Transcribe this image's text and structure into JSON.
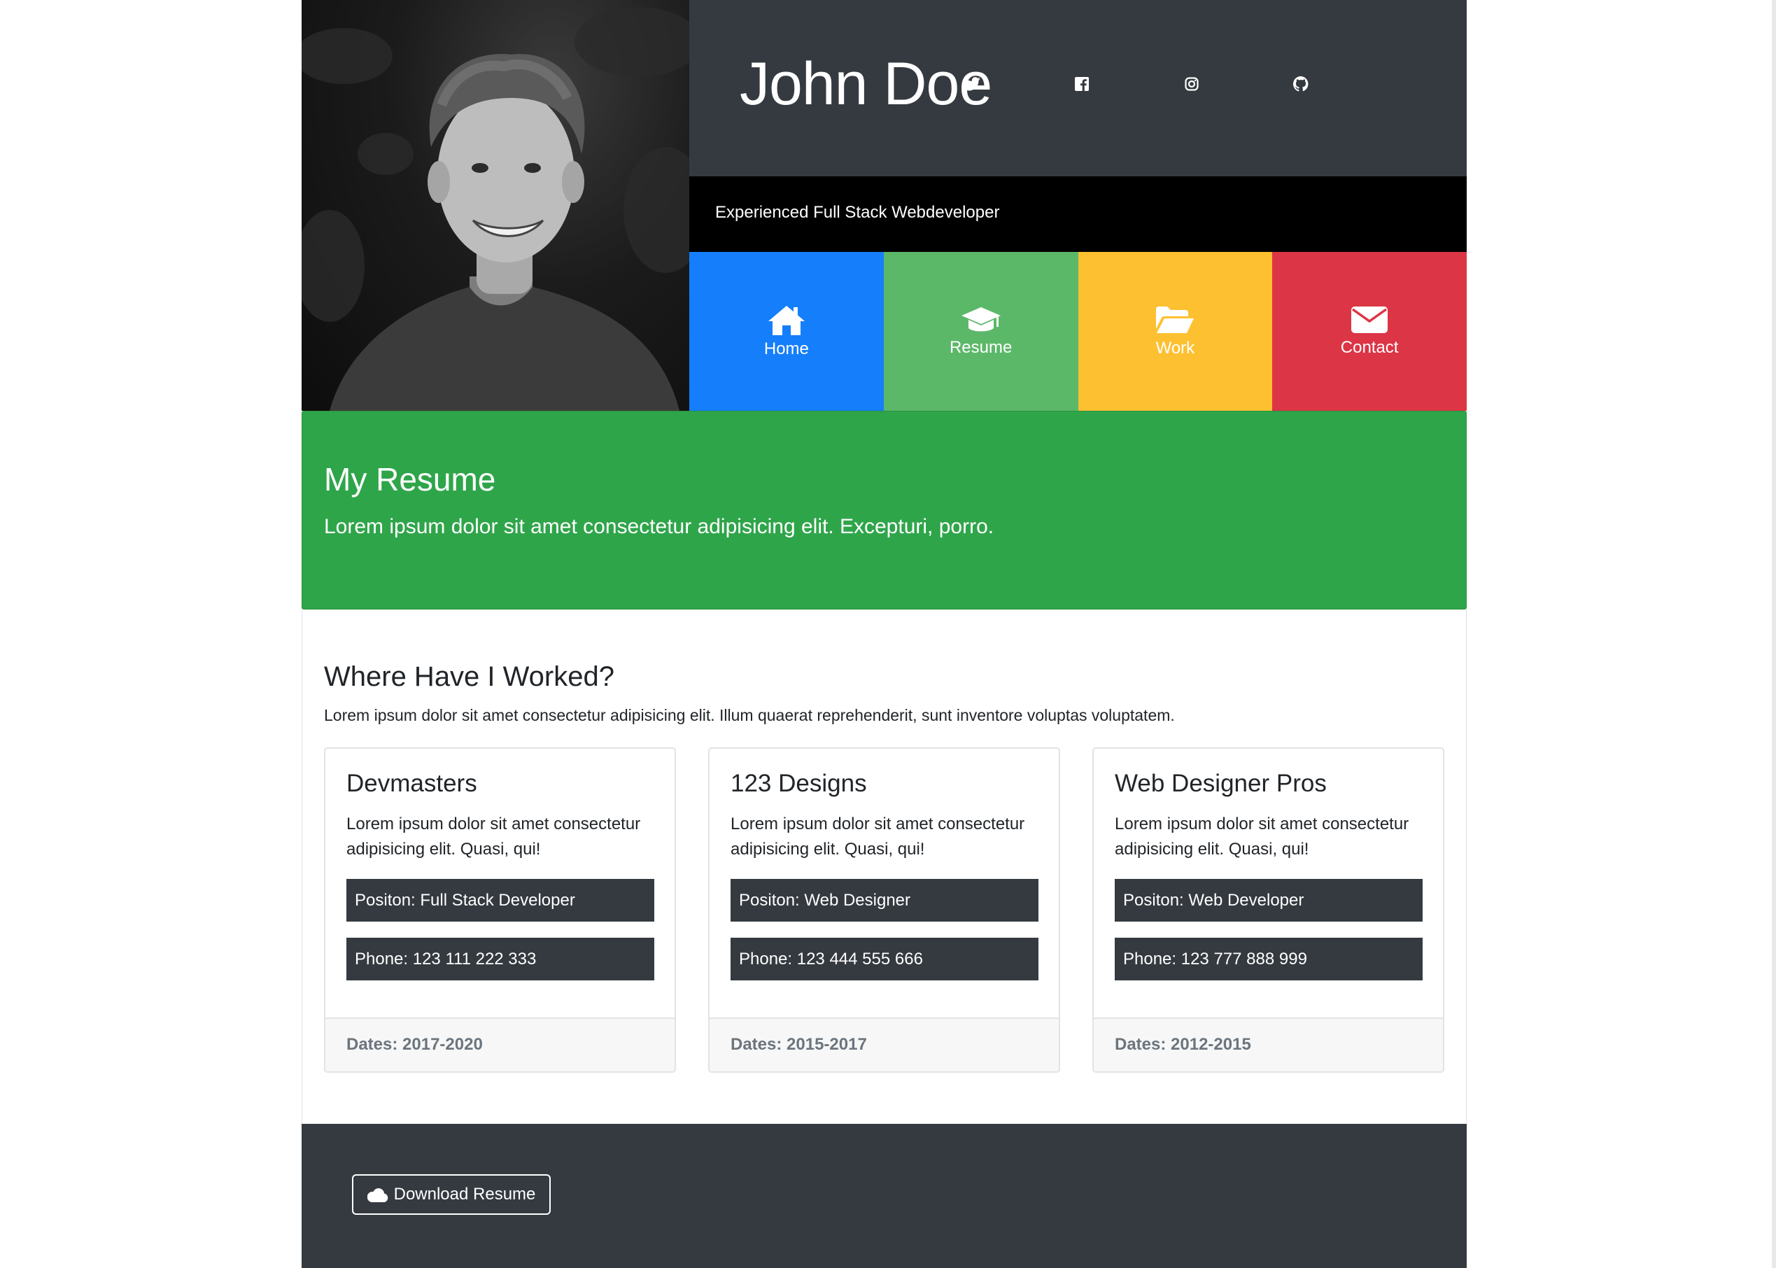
{
  "profile": {
    "name": "John Doe",
    "tagline": "Experienced Full Stack Webdeveloper"
  },
  "social": [
    {
      "icon": "twitter-icon"
    },
    {
      "icon": "facebook-icon"
    },
    {
      "icon": "instagram-icon"
    },
    {
      "icon": "github-icon"
    }
  ],
  "nav": [
    {
      "label": "Home",
      "icon": "home-icon",
      "color": "#157efb"
    },
    {
      "label": "Resume",
      "icon": "graduation-cap-icon",
      "color": "#5cb869"
    },
    {
      "label": "Work",
      "icon": "folder-open-icon",
      "color": "#fdc031"
    },
    {
      "label": "Contact",
      "icon": "envelope-icon",
      "color": "#dc3545"
    }
  ],
  "banner": {
    "title": "My Resume",
    "subtitle": "Lorem ipsum dolor sit amet consectetur adipisicing elit. Excepturi, porro.",
    "color": "#2fa54a"
  },
  "work": {
    "title": "Where Have I Worked?",
    "lead": "Lorem ipsum dolor sit amet consectetur adipisicing elit. Illum quaerat reprehenderit, sunt inventore voluptas voluptatem.",
    "jobs": [
      {
        "company": "Devmasters",
        "description": "Lorem ipsum dolor sit amet consectetur adipisicing elit. Quasi, qui!",
        "position": "Positon: Full Stack Developer",
        "phone": "Phone: 123 111 222 333",
        "dates": "Dates: 2017-2020"
      },
      {
        "company": "123 Designs",
        "description": "Lorem ipsum dolor sit amet consectetur adipisicing elit. Quasi, qui!",
        "position": "Positon: Web Designer",
        "phone": "Phone: 123 444 555 666",
        "dates": "Dates: 2015-2017"
      },
      {
        "company": "Web Designer Pros",
        "description": "Lorem ipsum dolor sit amet consectetur adipisicing elit. Quasi, qui!",
        "position": "Positon: Web Developer",
        "phone": "Phone: 123 777 888 999",
        "dates": "Dates: 2012-2015"
      }
    ]
  },
  "footer": {
    "download_label": "Download Resume",
    "download_icon": "cloud-icon"
  }
}
